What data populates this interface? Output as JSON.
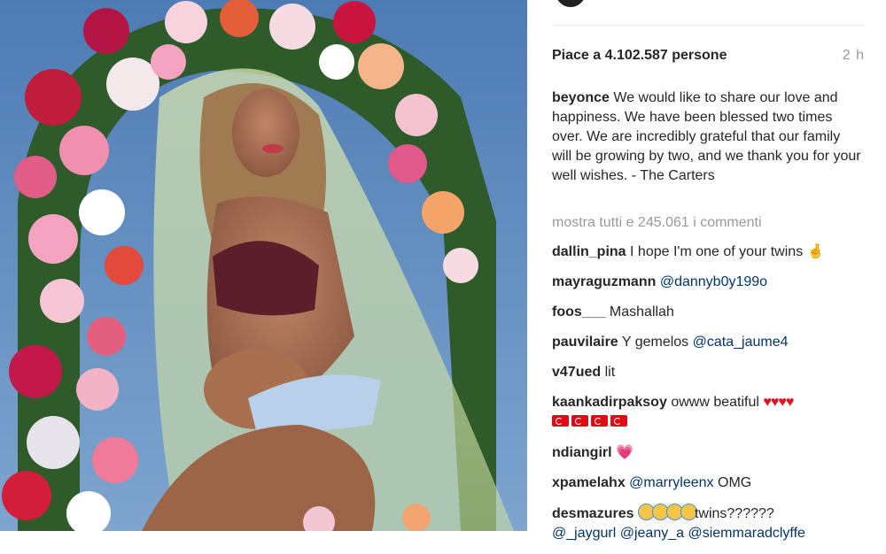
{
  "post": {
    "likes": "Piace a 4.102.587 persone",
    "time": "2 h",
    "caption_user": "beyonce",
    "caption_text": "We would like to share our love and happiness. We have been blessed two times over. We are incredibly grateful that our family will be growing by two, and we thank you for your well wishes. - The Carters",
    "view_all": "mostra tutti e 245.061 i commenti"
  },
  "comments": [
    {
      "user": "dallin_pina",
      "text": "I hope I'm one of your twins",
      "emoji": "hand-crossed-fingers-icon"
    },
    {
      "user": "mayraguzmann",
      "mention": "@dannyb0y199o"
    },
    {
      "user": "foos___",
      "text": "Mashallah"
    },
    {
      "user": "pauvilaire",
      "text": "Y gemelos",
      "mention": "@cata_jaume4"
    },
    {
      "user": "v47ued",
      "text": "lit"
    },
    {
      "user": "kaankadirpaksoy",
      "text": "owww beatiful",
      "hearts": "♥♥♥♥",
      "flags_icon": "turkish-flag-icon"
    },
    {
      "user": "ndiangirl",
      "emoji": "sparkling-heart-icon",
      "emoji_char": "💗"
    },
    {
      "user": "xpamelahx",
      "mention": "@marryleenx",
      "text": "OMG"
    },
    {
      "user": "desmazures",
      "emoji": "screaming-face-icon",
      "text": "twins??????",
      "mention1": "@_jaygurl",
      "mention2": "@jeany_a",
      "mention3": "@siemmaradclyffe"
    }
  ],
  "colors": {
    "text": "#262626",
    "muted": "#999999",
    "mention": "#003569",
    "sky": "#5b86b8"
  }
}
